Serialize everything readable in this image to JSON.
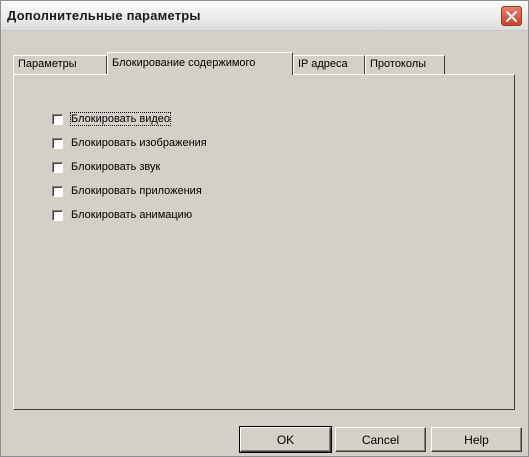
{
  "window": {
    "title": "Дополнительные параметры"
  },
  "tabs": [
    {
      "label": "Параметры",
      "active": false
    },
    {
      "label": "Блокирование содержимого",
      "active": true
    },
    {
      "label": "IP адреса",
      "active": false
    },
    {
      "label": "Протоколы",
      "active": false
    }
  ],
  "options": [
    {
      "label": "Блокировать видео",
      "checked": false
    },
    {
      "label": "Блокировать изображения",
      "checked": false
    },
    {
      "label": "Блокировать звук",
      "checked": false
    },
    {
      "label": "Блокировать приложения",
      "checked": false
    },
    {
      "label": "Блокировать анимацию",
      "checked": false
    }
  ],
  "buttons": {
    "ok": "OK",
    "cancel": "Cancel",
    "help": "Help"
  },
  "colors": {
    "dialog_bg": "#d4d0c8",
    "close_button": "#d2553a"
  },
  "icons": {
    "close": "close-x-icon"
  }
}
